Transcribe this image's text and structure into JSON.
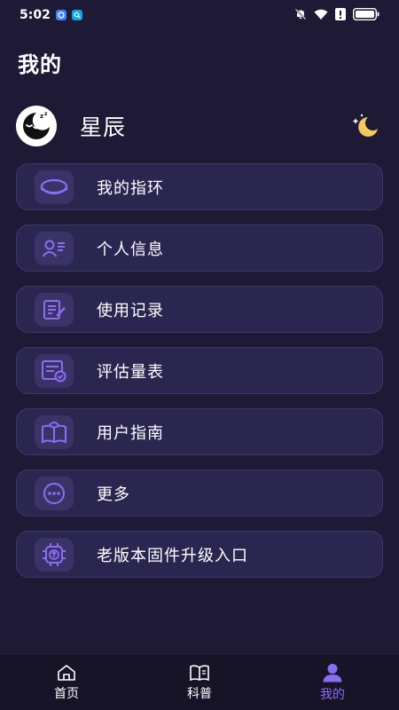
{
  "status_bar": {
    "time": "5:02",
    "icons": [
      "app-notification-icon",
      "search-app-icon",
      "mute-bell-icon",
      "wifi-icon",
      "alert-icon",
      "battery-icon"
    ]
  },
  "page": {
    "title": "我的"
  },
  "profile": {
    "name": "星辰",
    "avatar_icon": "sleeping-moon-icon",
    "theme_icon": "moon-star-icon"
  },
  "menu": {
    "items": [
      {
        "label": "我的指环",
        "icon": "ring-icon"
      },
      {
        "label": "个人信息",
        "icon": "user-card-icon"
      },
      {
        "label": "使用记录",
        "icon": "record-edit-icon"
      },
      {
        "label": "评估量表",
        "icon": "assessment-icon"
      },
      {
        "label": "用户指南",
        "icon": "guide-book-icon"
      },
      {
        "label": "更多",
        "icon": "more-icon"
      },
      {
        "label": "老版本固件升级入口",
        "icon": "firmware-chip-icon"
      }
    ]
  },
  "tabs": [
    {
      "label": "首页",
      "icon": "home-icon",
      "active": false
    },
    {
      "label": "科普",
      "icon": "book-icon",
      "active": false
    },
    {
      "label": "我的",
      "icon": "person-icon",
      "active": true
    }
  ],
  "colors": {
    "background": "#1e1a35",
    "card": "#2b2650",
    "card_border": "#3d3766",
    "icon_bg": "#3a3466",
    "accent": "#8b6cf6",
    "moon": "#f4c860"
  }
}
